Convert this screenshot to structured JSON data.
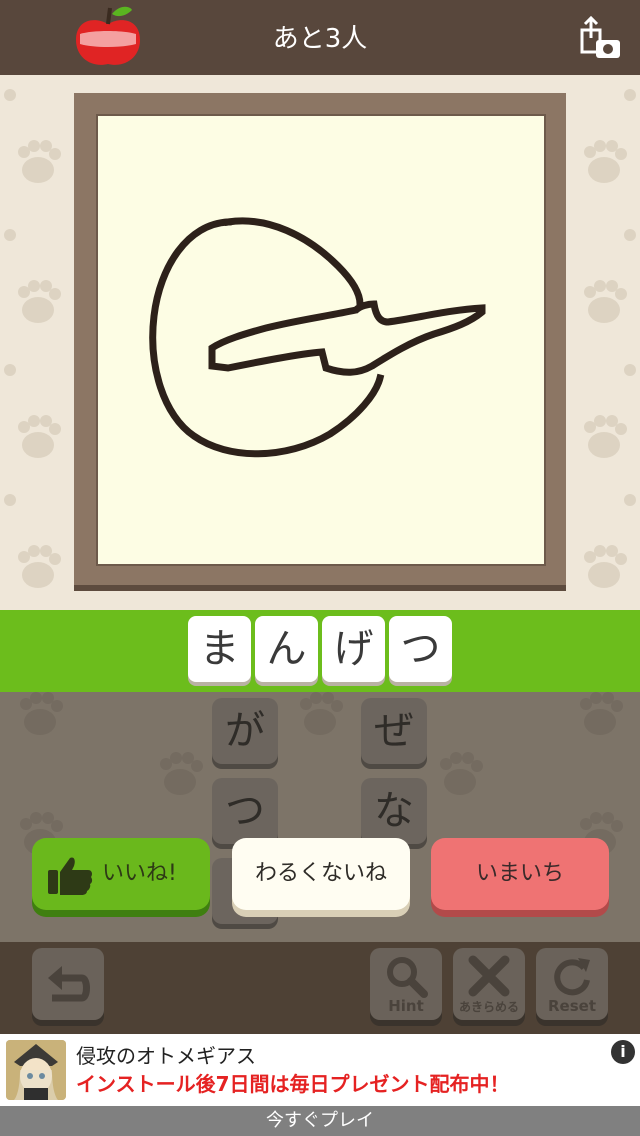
{
  "header": {
    "title": "あと3人",
    "left_icon": "apple-icon",
    "right_icon": "share-camera-icon"
  },
  "answer": {
    "letters": [
      "ま",
      "ん",
      "げ",
      "つ"
    ]
  },
  "keyboard": {
    "tiles": [
      "が",
      "ぜ",
      "つ",
      "な"
    ]
  },
  "rating": {
    "good_label": "いいね!",
    "ok_label": "わるくないね",
    "bad_label": "いまいち"
  },
  "toolbar": {
    "undo_icon": "undo-arrow-icon",
    "hint_label": "Hint",
    "giveup_label": "あきらめる",
    "reset_label": "Reset"
  },
  "ad": {
    "title": "侵攻のオトメギアス",
    "description": "インストール後7日間は毎日プレゼント配布中！",
    "info": "i",
    "cta": "今すぐプレイ"
  },
  "colors": {
    "header_bg": "#58473c",
    "answer_band": "#6cbd1c",
    "good_button": "#6ab81c",
    "bad_button": "#ef7373",
    "ad_red": "#e52222"
  }
}
